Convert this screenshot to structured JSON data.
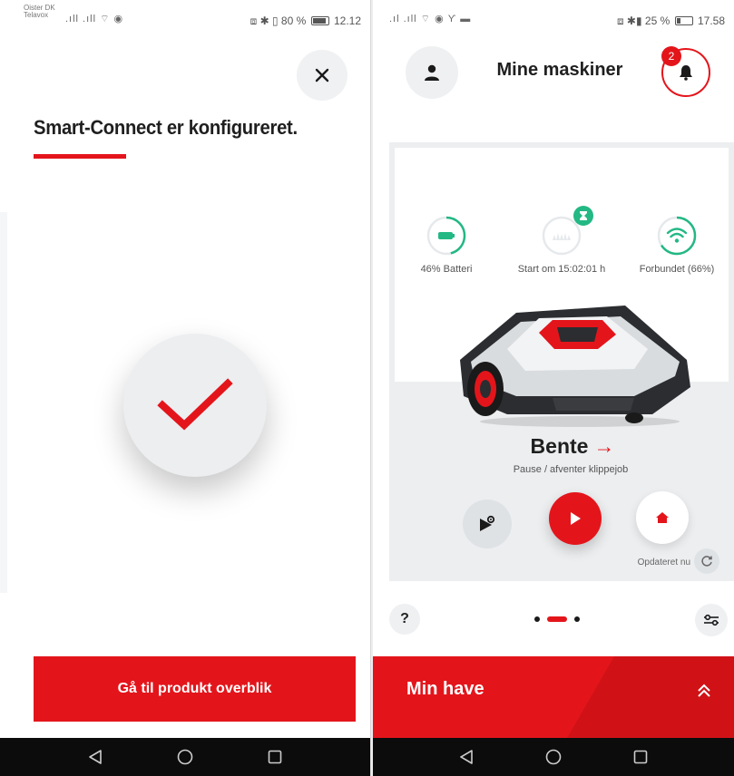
{
  "left": {
    "status": {
      "carrier_line1": "Oister DK",
      "carrier_line2": "Telavox",
      "icons_left": ".ıll .ıll ⌔ ◉",
      "icons_right": "⧈ ✱ ▯",
      "battery": "80 %",
      "time": "12.12"
    },
    "close_icon": "close-icon",
    "title": "Smart-Connect er konfigureret.",
    "success_icon": "checkmark-icon",
    "primary_button": "Gå til produkt overblik"
  },
  "right": {
    "status": {
      "icons_left": ".ıl .ıll ⌔ ◉ ϒ ▬",
      "icons_right": "⧈ ✱▮",
      "battery": "25 %",
      "time": "17.58"
    },
    "header": {
      "title": "Mine maskiner",
      "notification_count": "2"
    },
    "stats": [
      {
        "label": "46% Batteri",
        "icon": "battery-icon",
        "value_pct": 46
      },
      {
        "label": "Start om 15:02:01 h",
        "icon": "hourglass-icon"
      },
      {
        "label": "Forbundet (66%)",
        "icon": "wifi-icon",
        "value_pct": 66
      }
    ],
    "mower": {
      "name": "Bente",
      "arrow": "→",
      "status": "Pause / afventer klippejob"
    },
    "updated": "Opdateret nu",
    "help_label": "?",
    "garden_title": "Min have"
  },
  "colors": {
    "brand_red": "#e3151b",
    "success_green": "#23b884",
    "surface_gray": "#eceef0"
  }
}
